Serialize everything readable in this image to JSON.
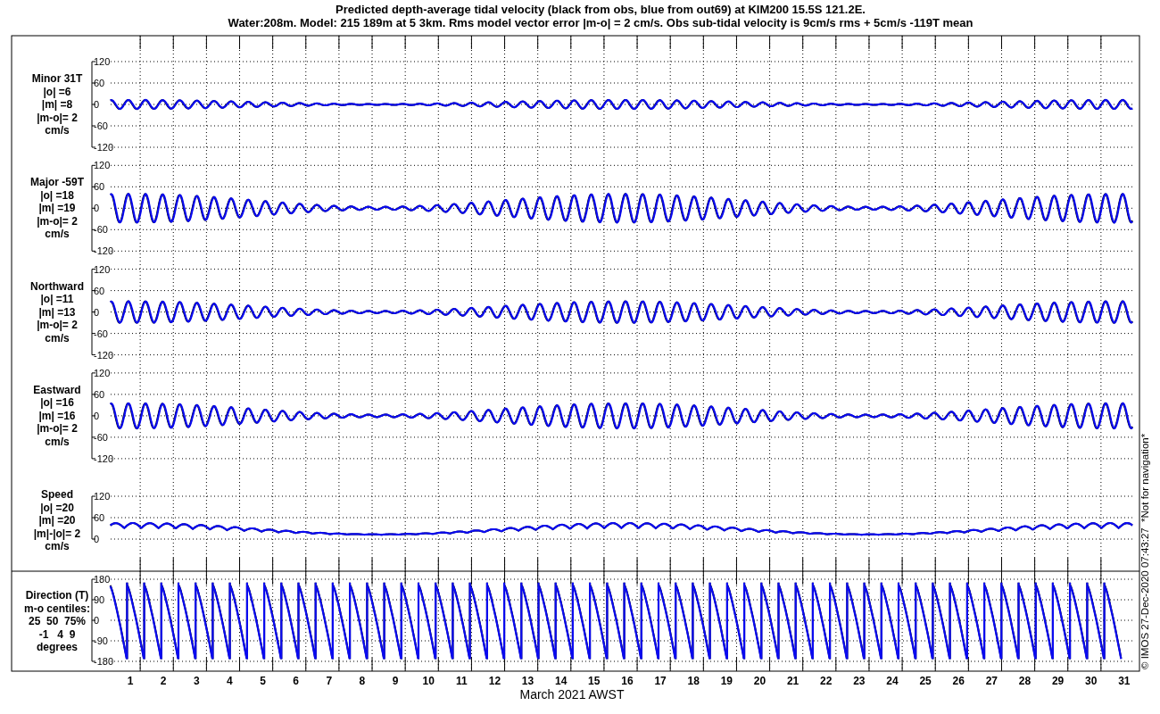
{
  "title_lines": [
    "Predicted depth-average tidal velocity (black from obs, blue from out69) at KIM200 15.5S 121.2E.",
    "Water:208m. Model: 215 189m at 5 3km. Rms model vector error |m-o| = 2 cm/s. Obs sub-tidal velocity is 9cm/s rms + 5cm/s -119T mean"
  ],
  "panels": [
    {
      "kind": "velocity",
      "label_lines": [
        "Minor 31T",
        "|o| =6",
        "|m| =8",
        "|m-o|= 2",
        "cm/s"
      ],
      "yticks": [
        "120",
        "60",
        "0",
        "-60",
        "-120"
      ]
    },
    {
      "kind": "velocity",
      "label_lines": [
        "Major -59T",
        "|o| =18",
        "|m| =19",
        "|m-o|= 2",
        "cm/s"
      ],
      "yticks": [
        "120",
        "60",
        "0",
        "-60",
        "-120"
      ]
    },
    {
      "kind": "velocity",
      "label_lines": [
        "Northward",
        "|o| =11",
        "|m| =13",
        "|m-o|= 2",
        "cm/s"
      ],
      "yticks": [
        "120",
        "60",
        "0",
        "-60",
        "-120"
      ]
    },
    {
      "kind": "velocity",
      "label_lines": [
        "Eastward",
        "|o| =16",
        "|m| =16",
        "|m-o|= 2",
        "cm/s"
      ],
      "yticks": [
        "120",
        "60",
        "0",
        "-60",
        "-120"
      ]
    },
    {
      "kind": "speed",
      "label_lines": [
        "Speed",
        "|o| =20",
        "|m| =20",
        "|m|-|o|= 2",
        "cm/s"
      ],
      "yticks": [
        "120",
        "60",
        "0"
      ]
    },
    {
      "kind": "direction",
      "label_lines": [
        "Direction (T)",
        "m-o centiles:",
        "25  50  75%",
        "-1   4  9",
        "degrees"
      ],
      "yticks": [
        "180",
        "90",
        "0",
        "-90",
        "-180"
      ]
    }
  ],
  "x_tick_labels": [
    "1",
    "2",
    "3",
    "4",
    "5",
    "6",
    "7",
    "8",
    "9",
    "10",
    "11",
    "12",
    "13",
    "14",
    "15",
    "16",
    "17",
    "18",
    "19",
    "20",
    "21",
    "22",
    "23",
    "24",
    "25",
    "26",
    "27",
    "28",
    "29",
    "30",
    "31"
  ],
  "xlabel": "March 2021 AWST",
  "side_note": "© IMOS 27-Dec-2020 07:43:27  *Not for navigation*"
}
